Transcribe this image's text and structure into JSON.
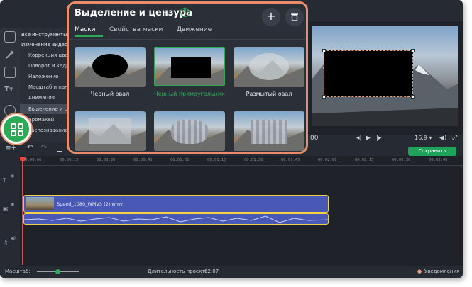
{
  "panel": {
    "title": "Выделение и цензура",
    "help_label": "?",
    "add_label": "+",
    "tabs": [
      "Маски",
      "Свойства маски",
      "Движение"
    ],
    "active_tab": "Маски",
    "masks": [
      {
        "label": "Черный овал",
        "selected": false
      },
      {
        "label": "Черный прямоугольник",
        "selected": true
      },
      {
        "label": "Размытый овал",
        "selected": false
      },
      {
        "label": "",
        "selected": false
      },
      {
        "label": "",
        "selected": false
      },
      {
        "label": "",
        "selected": false
      }
    ]
  },
  "tools": {
    "items": [
      {
        "label": "Все инструменты",
        "head": true
      },
      {
        "label": "Изменение видео",
        "head": true
      },
      {
        "label": "Коррекция цвета"
      },
      {
        "label": "Поворот и кадрирование"
      },
      {
        "label": "Наложение"
      },
      {
        "label": "Масштаб и панорама"
      },
      {
        "label": "Анимация"
      },
      {
        "label": "Выделение и цензура",
        "active": true
      },
      {
        "label": "Хромакей"
      },
      {
        "label": "Распознавание"
      }
    ]
  },
  "player": {
    "aspect": "16:9",
    "save_label": "Сохранить"
  },
  "timeline": {
    "ruler": [
      "00:00:00",
      "00:00:15",
      "00:00:30",
      "00:00:45",
      "00:01:00",
      "00:01:15",
      "00:01:30",
      "00:01:45",
      "00:02:00",
      "00:02:15",
      "00:02:30",
      "00:02:45"
    ],
    "clip_name": "Speed_1080_WMV3 (2).wmv"
  },
  "status": {
    "scale_label": "Масштаб:",
    "duration_label": "Длительность проекта:",
    "duration_value": "02:07",
    "notifications": "Уведомления"
  },
  "colors": {
    "accent": "#2bab55",
    "callout": "#ea8c6a",
    "clip": "#4a58b5",
    "playhead": "#e8453c"
  }
}
